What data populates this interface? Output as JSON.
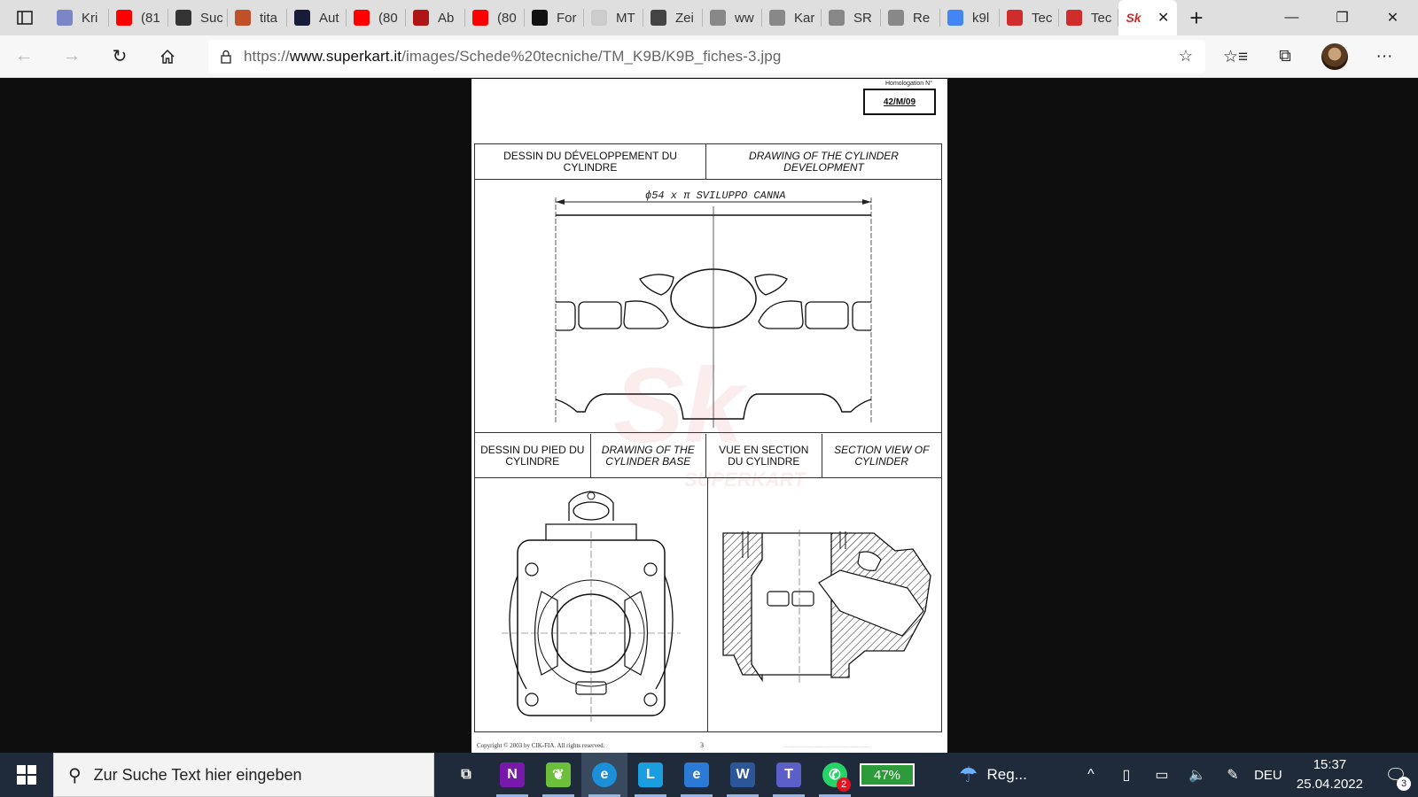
{
  "browser": {
    "tabs": [
      {
        "title": "Kri",
        "icon": "document-icon",
        "color": "#7a86c8"
      },
      {
        "title": "(81",
        "icon": "youtube-icon",
        "color": "#ff0000"
      },
      {
        "title": "Suc",
        "icon": "site-icon",
        "color": "#333333"
      },
      {
        "title": "tita",
        "icon": "site-icon",
        "color": "#c0502a"
      },
      {
        "title": "Aut",
        "icon": "site-icon",
        "color": "#1a1a3a"
      },
      {
        "title": "(80",
        "icon": "youtube-icon",
        "color": "#ff0000"
      },
      {
        "title": "Ab",
        "icon": "abarth-icon",
        "color": "#b01515"
      },
      {
        "title": "(80",
        "icon": "youtube-icon",
        "color": "#ff0000"
      },
      {
        "title": "For",
        "icon": "site-icon",
        "color": "#111111"
      },
      {
        "title": "MT",
        "icon": "site-icon",
        "color": "#cccccc"
      },
      {
        "title": "Zei",
        "icon": "site-icon",
        "color": "#444444"
      },
      {
        "title": "ww",
        "icon": "site-icon",
        "color": "#888888"
      },
      {
        "title": "Kar",
        "icon": "document-icon",
        "color": "#888888"
      },
      {
        "title": "SR",
        "icon": "document-icon",
        "color": "#888888"
      },
      {
        "title": "Re",
        "icon": "document-icon",
        "color": "#888888"
      },
      {
        "title": "k9l",
        "icon": "google-icon",
        "color": "#4285f4"
      },
      {
        "title": "Tec",
        "icon": "superkart-icon",
        "color": "#d12c2c"
      },
      {
        "title": "Tec",
        "icon": "superkart-icon",
        "color": "#d12c2c"
      }
    ],
    "active_tab": {
      "icon": "superkart-icon",
      "color": "#d12c2c"
    },
    "url": {
      "scheme": "https://",
      "host": "www.superkart.it",
      "path": "/images/Schede%20tecniche/TM_K9B/K9B_fiches-3.jpg"
    }
  },
  "document": {
    "homologation_label": "Homologation N°",
    "homologation_number": "42/M/09",
    "section1": {
      "fr": "DESSIN DU DÉVELOPPEMENT DU CYLINDRE",
      "en": "DRAWING OF THE CYLINDER DEVELOPMENT",
      "handwritten": "ϕ54 x π  SVILUPPO  CANNA"
    },
    "section2": {
      "fr_base": "DESSIN DU PIED DU CYLINDRE",
      "en_base": "DRAWING OF THE CYLINDER BASE",
      "fr_section": "VUE EN SECTION DU CYLINDRE",
      "en_section": "SECTION VIEW OF CYLINDER"
    },
    "watermark_text": "SUPERKART",
    "footer_copyright": "Copyright © 2003 by CIK-FIA. All rights reserved.",
    "footer_page": "3"
  },
  "taskbar": {
    "search_placeholder": "Zur Suche Text hier eingeben",
    "apps": [
      {
        "name": "task-view-icon",
        "glyph": "⧉",
        "color": "transparent"
      },
      {
        "name": "onenote-icon",
        "glyph": "N",
        "color": "#7719aa"
      },
      {
        "name": "leaf-app-icon",
        "glyph": "❦",
        "color": "#6cbf3a"
      },
      {
        "name": "edge-icon",
        "glyph": "e",
        "color": "#1b8fd8"
      },
      {
        "name": "l-app-icon",
        "glyph": "L",
        "color": "#1a9ee0"
      },
      {
        "name": "internet-explorer-icon",
        "glyph": "e",
        "color": "#2a7ad6"
      },
      {
        "name": "word-icon",
        "glyph": "W",
        "color": "#2b579a"
      },
      {
        "name": "teams-icon",
        "glyph": "T",
        "color": "#5b5fc7"
      },
      {
        "name": "whatsapp-icon",
        "glyph": "✆",
        "color": "#25d366"
      }
    ],
    "whatsapp_badge": "2",
    "battery_label": "47%",
    "weather_label": "Reg...",
    "language": "DEU",
    "time": "15:37",
    "date": "25.04.2022",
    "notification_count": "3"
  }
}
